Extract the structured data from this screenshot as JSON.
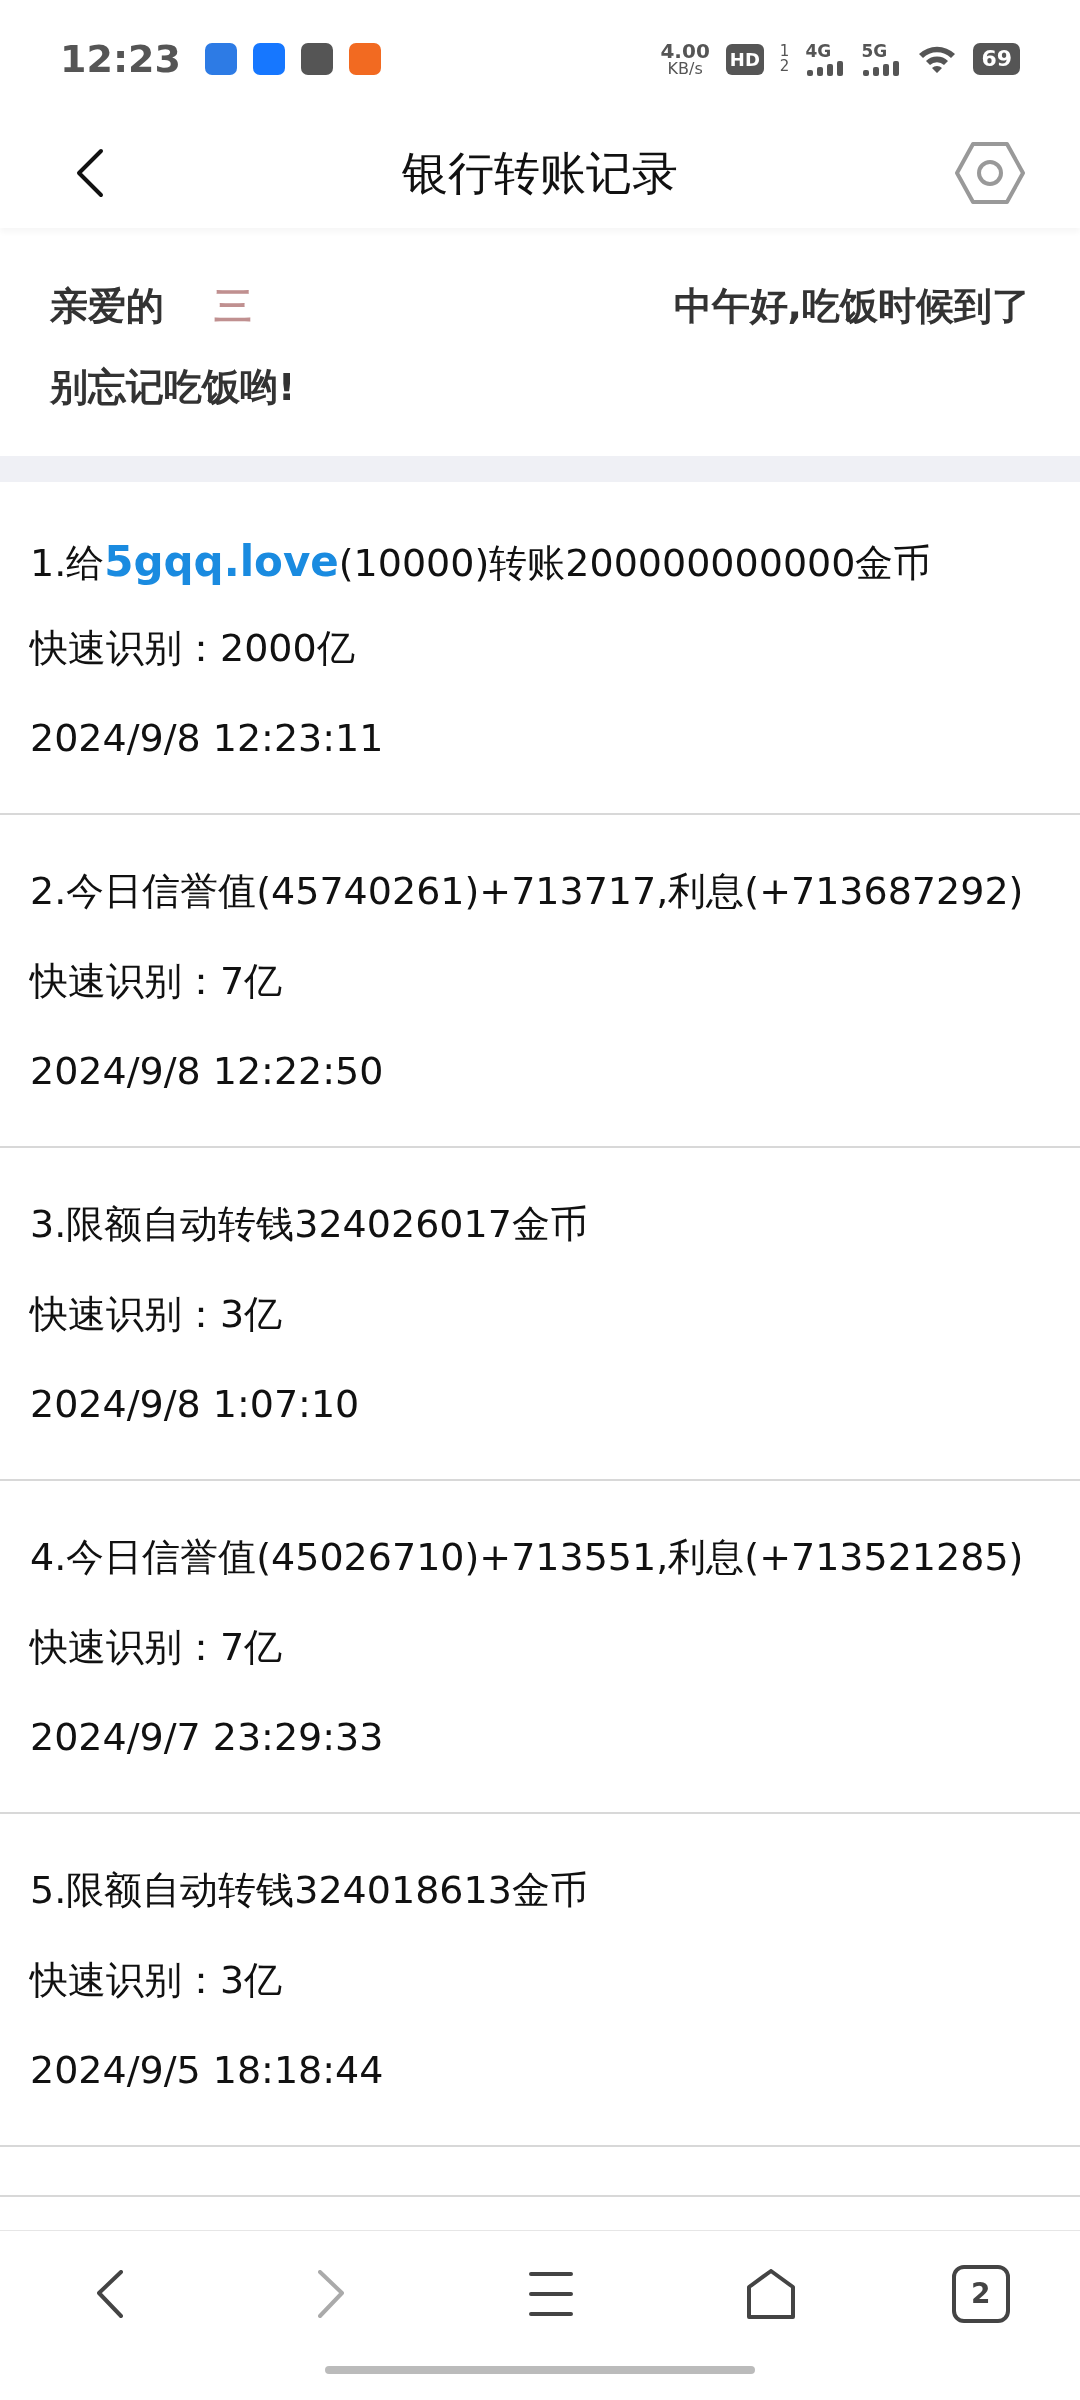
{
  "status_bar": {
    "time": "12:23",
    "speed_value": "4.00",
    "speed_unit": "KB/s",
    "hd": "HD",
    "sim_1": "1",
    "sim_2": "2",
    "net_1": "4G",
    "net_2": "5G",
    "battery": "69"
  },
  "header": {
    "title": "银行转账记录"
  },
  "greeting": {
    "line_1_start": "亲爱的",
    "name": "三",
    "line_1_end": "中午好,吃饭时候到了",
    "line_2": "别忘记吃饭哟!"
  },
  "records": [
    {
      "parts": [
        {
          "kind": "plain",
          "text": "1.给"
        },
        {
          "kind": "brand",
          "text": "5gqq.love"
        },
        {
          "kind": "plain",
          "text": "(10000)转账200000000000金币"
        }
      ],
      "quick": "快速识别：2000亿",
      "time": "2024/9/8 12:23:11"
    },
    {
      "parts": [
        {
          "kind": "plain",
          "text": "2.今日信誉值(45740261)+713717,利息(+713687292)"
        }
      ],
      "quick": "快速识别：7亿",
      "time": "2024/9/8 12:22:50"
    },
    {
      "parts": [
        {
          "kind": "plain",
          "text": "3.限额自动转钱324026017金币"
        }
      ],
      "quick": "快速识别：3亿",
      "time": "2024/9/8 1:07:10"
    },
    {
      "parts": [
        {
          "kind": "plain",
          "text": "4.今日信誉值(45026710)+713551,利息(+713521285)"
        }
      ],
      "quick": "快速识别：7亿",
      "time": "2024/9/7 23:29:33"
    },
    {
      "parts": [
        {
          "kind": "plain",
          "text": "5.限额自动转钱324018613金币"
        }
      ],
      "quick": "快速识别：3亿",
      "time": "2024/9/5 18:18:44"
    }
  ],
  "bottom_nav": [
    {
      "kind": "back",
      "disabled": false
    },
    {
      "kind": "forward",
      "disabled": true
    },
    {
      "kind": "menu",
      "disabled": false
    },
    {
      "kind": "home",
      "disabled": false
    },
    {
      "kind": "tabs",
      "disabled": false,
      "count": "2"
    }
  ]
}
